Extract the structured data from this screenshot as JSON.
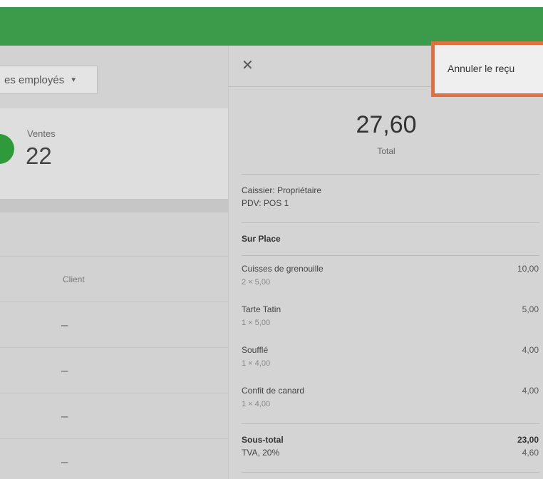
{
  "left": {
    "employee_filter": "es employés",
    "stat_label": "Ventes",
    "stat_value": "22",
    "client_header": "Client",
    "rows": [
      "–",
      "–",
      "–",
      "–"
    ]
  },
  "receipt": {
    "close_icon": "close-icon",
    "cancel_label": "Annuler le reçu",
    "total": "27,60",
    "total_label": "Total",
    "cashier": "Caissier: Propriétaire",
    "pos": "PDV: POS 1",
    "dining_option": "Sur Place",
    "items": [
      {
        "name": "Cuisses de grenouille",
        "qty": "2 × 5,00",
        "amount": "10,00"
      },
      {
        "name": "Tarte Tatin",
        "qty": "1 × 5,00",
        "amount": "5,00"
      },
      {
        "name": "Soufflé",
        "qty": "1 × 4,00",
        "amount": "4,00"
      },
      {
        "name": "Confit de canard",
        "qty": "1 × 4,00",
        "amount": "4,00"
      }
    ],
    "subtotal_label": "Sous-total",
    "subtotal": "23,00",
    "tax_label": "TVA, 20%",
    "tax": "4,60"
  },
  "colors": {
    "topbar": "#3b9b4b",
    "highlight": "#e0703f",
    "stat_circle": "#2f9a3a"
  }
}
